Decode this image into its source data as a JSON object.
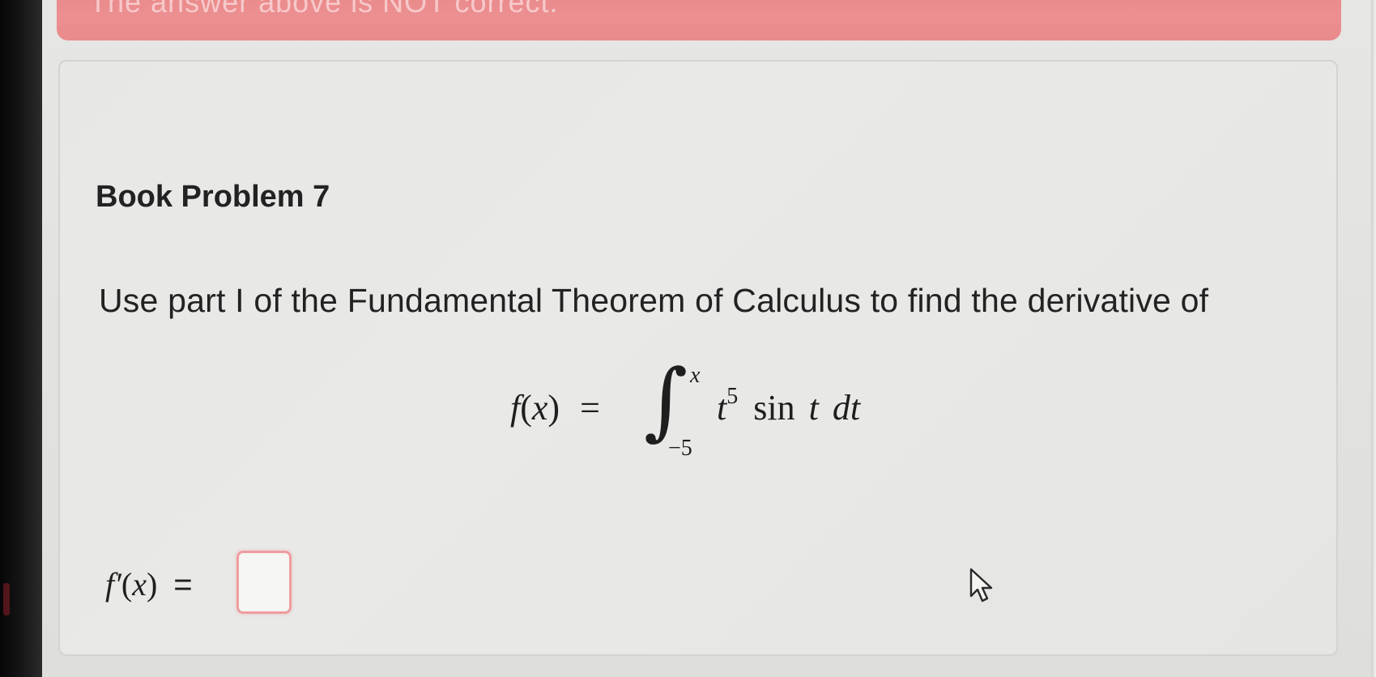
{
  "feedback": {
    "text": "The answer above is NOT correct."
  },
  "problem": {
    "title": "Book Problem 7",
    "prompt": "Use part I of the Fundamental Theorem of Calculus to find the derivative of",
    "equation": {
      "lhs_func": "f",
      "lhs_var": "x",
      "equals": "=",
      "upper_limit": "x",
      "lower_limit": "−5",
      "integrand_base": "t",
      "integrand_exp": "5",
      "integrand_func": "sin",
      "integrand_arg": "t",
      "differential": "dt"
    }
  },
  "answer": {
    "label_func": "f′",
    "label_var": "x",
    "equals": "=",
    "value": ""
  },
  "colors": {
    "banner": "#e98a8b",
    "input_border": "#ef9da0",
    "card": "#e8e8e6"
  },
  "icons": {
    "cursor": "mouse-pointer-icon"
  }
}
